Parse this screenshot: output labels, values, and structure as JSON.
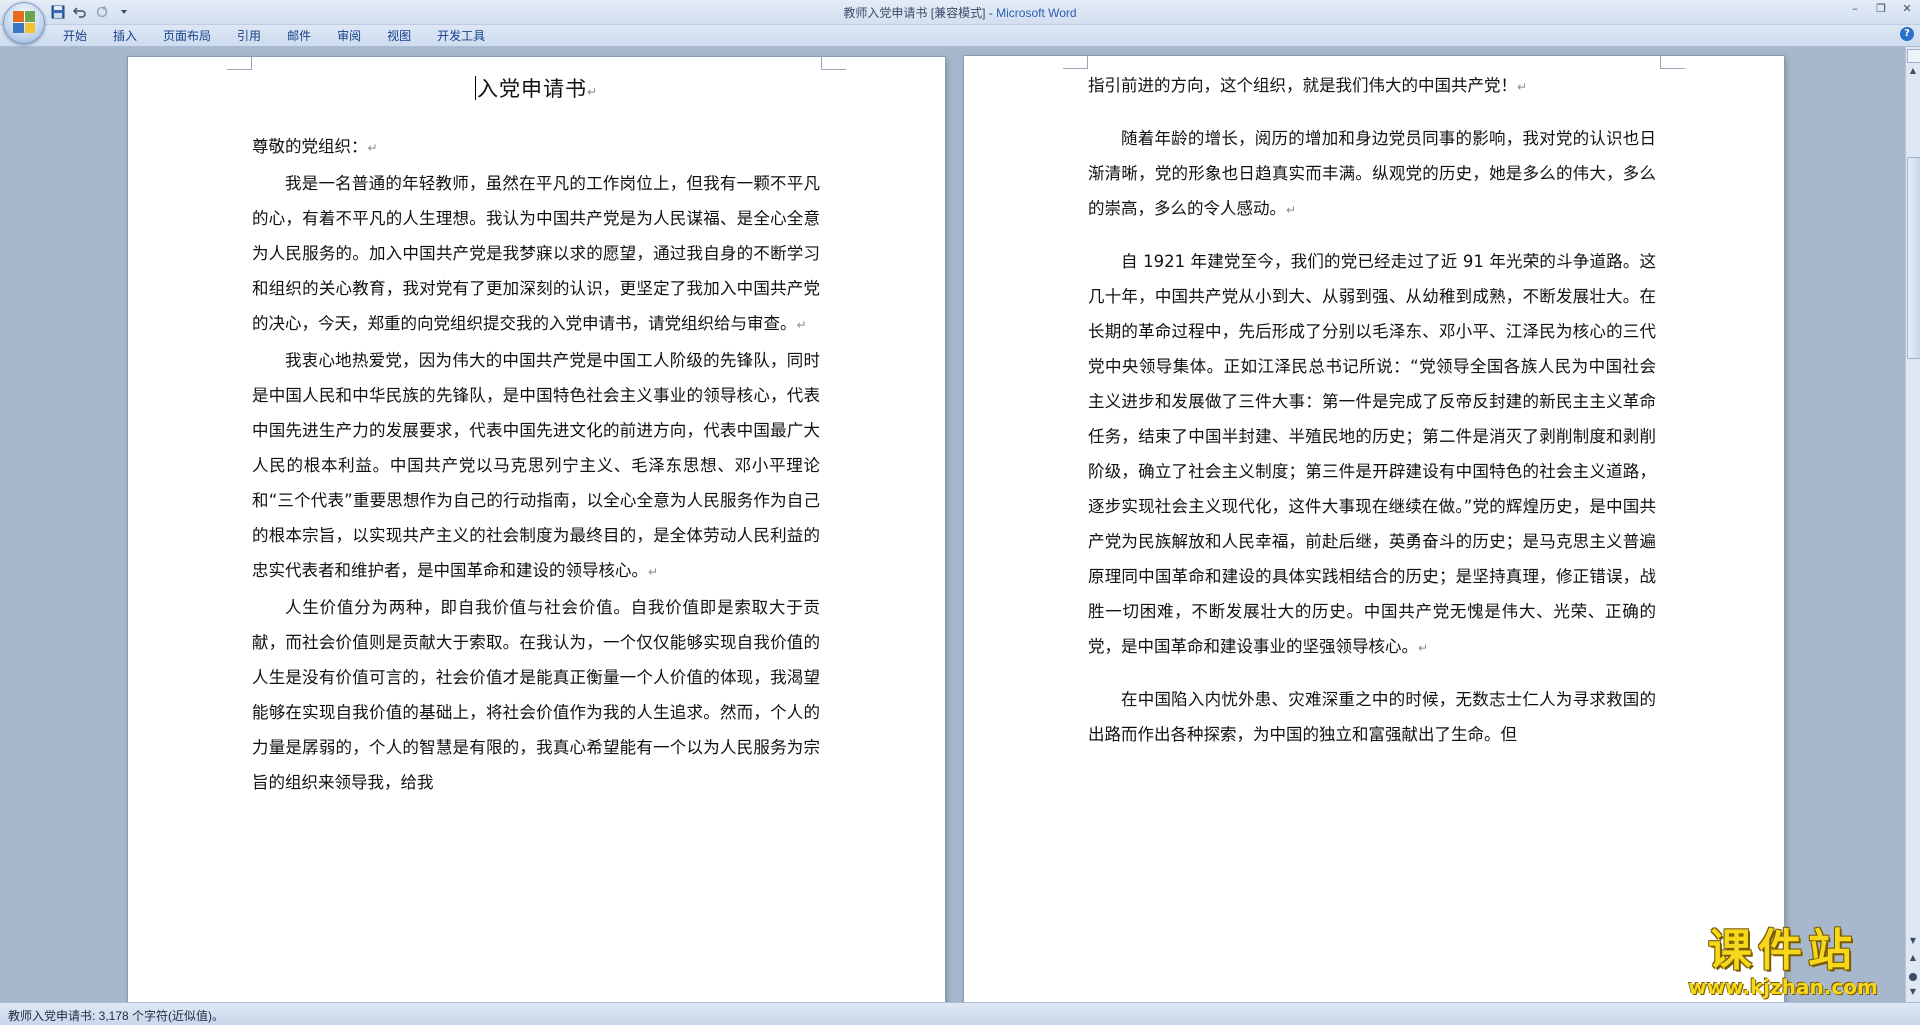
{
  "window": {
    "doc_name": "教师入党申请书 [兼容模式]",
    "separator": " - ",
    "app_name": "Microsoft Word"
  },
  "qat": {
    "save_icon": "save-icon",
    "undo_icon": "undo-icon",
    "redo_icon": "redo-icon",
    "customize_icon": "dropdown-arrow-icon"
  },
  "ribbon": {
    "tabs": [
      "开始",
      "插入",
      "页面布局",
      "引用",
      "邮件",
      "审阅",
      "视图",
      "开发工具"
    ]
  },
  "document": {
    "title": "入党申请书",
    "left_page": [
      "尊敬的党组织：",
      "我是一名普通的年轻教师，虽然在平凡的工作岗位上，但我有一颗不平凡的心，有着不平凡的人生理想。我认为中国共产党是为人民谋福、是全心全意为人民服务的。加入中国共产党是我梦寐以求的愿望，通过我自身的不断学习和组织的关心教育，我对党有了更加深刻的认识，更坚定了我加入中国共产党的决心，今天，郑重的向党组织提交我的入党申请书，请党组织给与审查。",
      "我衷心地热爱党，因为伟大的中国共产党是中国工人阶级的先锋队，同时是中国人民和中华民族的先锋队，是中国特色社会主义事业的领导核心，代表中国先进生产力的发展要求，代表中国先进文化的前进方向，代表中国最广大人民的根本利益。中国共产党以马克思列宁主义、毛泽东思想、邓小平理论和“三个代表”重要思想作为自己的行动指南，以全心全意为人民服务作为自己的根本宗旨，以实现共产主义的社会制度为最终目的，是全体劳动人民利益的忠实代表者和维护者，是中国革命和建设的领导核心。",
      "人生价值分为两种，即自我价值与社会价值。自我价值即是索取大于贡献，而社会价值则是贡献大于索取。在我认为，一个仅仅能够实现自我价值的人生是没有价值可言的，社会价值才是能真正衡量一个人价值的体现，我渴望能够在实现自我价值的基础上，将社会价值作为我的人生追求。然而，个人的力量是孱弱的，个人的智慧是有限的，我真心希望能有一个以为人民服务为宗旨的组织来领导我，给我"
    ],
    "right_page": [
      "指引前进的方向，这个组织，就是我们伟大的中国共产党！",
      "随着年龄的增长，阅历的增加和身边党员同事的影响，我对党的认识也日渐清晰，党的形象也日趋真实而丰满。纵观党的历史，她是多么的伟大，多么的崇高，多么的令人感动。",
      "自 1921 年建党至今，我们的党已经走过了近 91 年光荣的斗争道路。这几十年，中国共产党从小到大、从弱到强、从幼稚到成熟，不断发展壮大。在长期的革命过程中，先后形成了分别以毛泽东、邓小平、江泽民为核心的三代党中央领导集体。正如江泽民总书记所说：“党领导全国各族人民为中国社会主义进步和发展做了三件大事：第一件是完成了反帝反封建的新民主主义革命任务，结束了中国半封建、半殖民地的历史；第二件是消灭了剥削制度和剥削阶级，确立了社会主义制度；第三件是开辟建设有中国特色的社会主义道路，逐步实现社会主义现代化，这件大事现在继续在做。”党的辉煌历史，是中国共产党为民族解放和人民幸福，前赴后继，英勇奋斗的历史；是马克思主义普遍原理同中国革命和建设的具体实践相结合的历史；是坚持真理，修正错误，战胜一切困难，不断发展壮大的历史。中国共产党无愧是伟大、光荣、正确的党，是中国革命和建设事业的坚强领导核心。",
      "在中国陷入内忧外患、灾难深重之中的时候，无数志士仁人为寻求救国的出路而作出各种探索，为中国的独立和富强献出了生命。但"
    ],
    "paragraph_mark": "↵"
  },
  "watermark": {
    "main": "课件站",
    "url": "www.kjzhan.com"
  },
  "status_bar": {
    "text": "教师入党申请书: 3,178 个字符(近似值)。"
  },
  "colors": {
    "app_title": "#2a60b0",
    "tab_text": "#15428b",
    "watermark": "#f5d81c"
  }
}
